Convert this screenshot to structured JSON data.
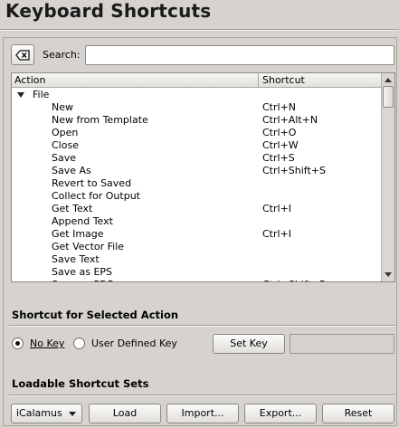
{
  "dialog": {
    "title": "Keyboard Shortcuts"
  },
  "search": {
    "label": "Search:",
    "value": "",
    "placeholder": ""
  },
  "tree": {
    "columns": {
      "action": "Action",
      "shortcut": "Shortcut"
    },
    "group": "File",
    "rows": [
      {
        "name": "New",
        "shortcut": "Ctrl+N"
      },
      {
        "name": "New from Template",
        "shortcut": "Ctrl+Alt+N"
      },
      {
        "name": "Open",
        "shortcut": "Ctrl+O"
      },
      {
        "name": "Close",
        "shortcut": "Ctrl+W"
      },
      {
        "name": "Save",
        "shortcut": "Ctrl+S"
      },
      {
        "name": "Save As",
        "shortcut": "Ctrl+Shift+S"
      },
      {
        "name": "Revert to Saved",
        "shortcut": ""
      },
      {
        "name": "Collect for Output",
        "shortcut": ""
      },
      {
        "name": "Get Text",
        "shortcut": "Ctrl+I"
      },
      {
        "name": "Append Text",
        "shortcut": ""
      },
      {
        "name": "Get Image",
        "shortcut": "Ctrl+I"
      },
      {
        "name": "Get Vector File",
        "shortcut": ""
      },
      {
        "name": "Save Text",
        "shortcut": ""
      },
      {
        "name": "Save as EPS",
        "shortcut": ""
      },
      {
        "name": "Save as PDF",
        "shortcut": "Ctrl+Shift+P"
      }
    ]
  },
  "selected_action": {
    "heading": "Shortcut for Selected Action",
    "no_key": "No Key",
    "user_defined": "User Defined Key",
    "set_key": "Set Key",
    "key_value": ""
  },
  "sets": {
    "heading": "Loadable Shortcut Sets",
    "selected": "iCalamus",
    "load": "Load",
    "import": "Import...",
    "export": "Export...",
    "reset": "Reset"
  },
  "icons": {
    "clear": "clear-field-icon"
  }
}
